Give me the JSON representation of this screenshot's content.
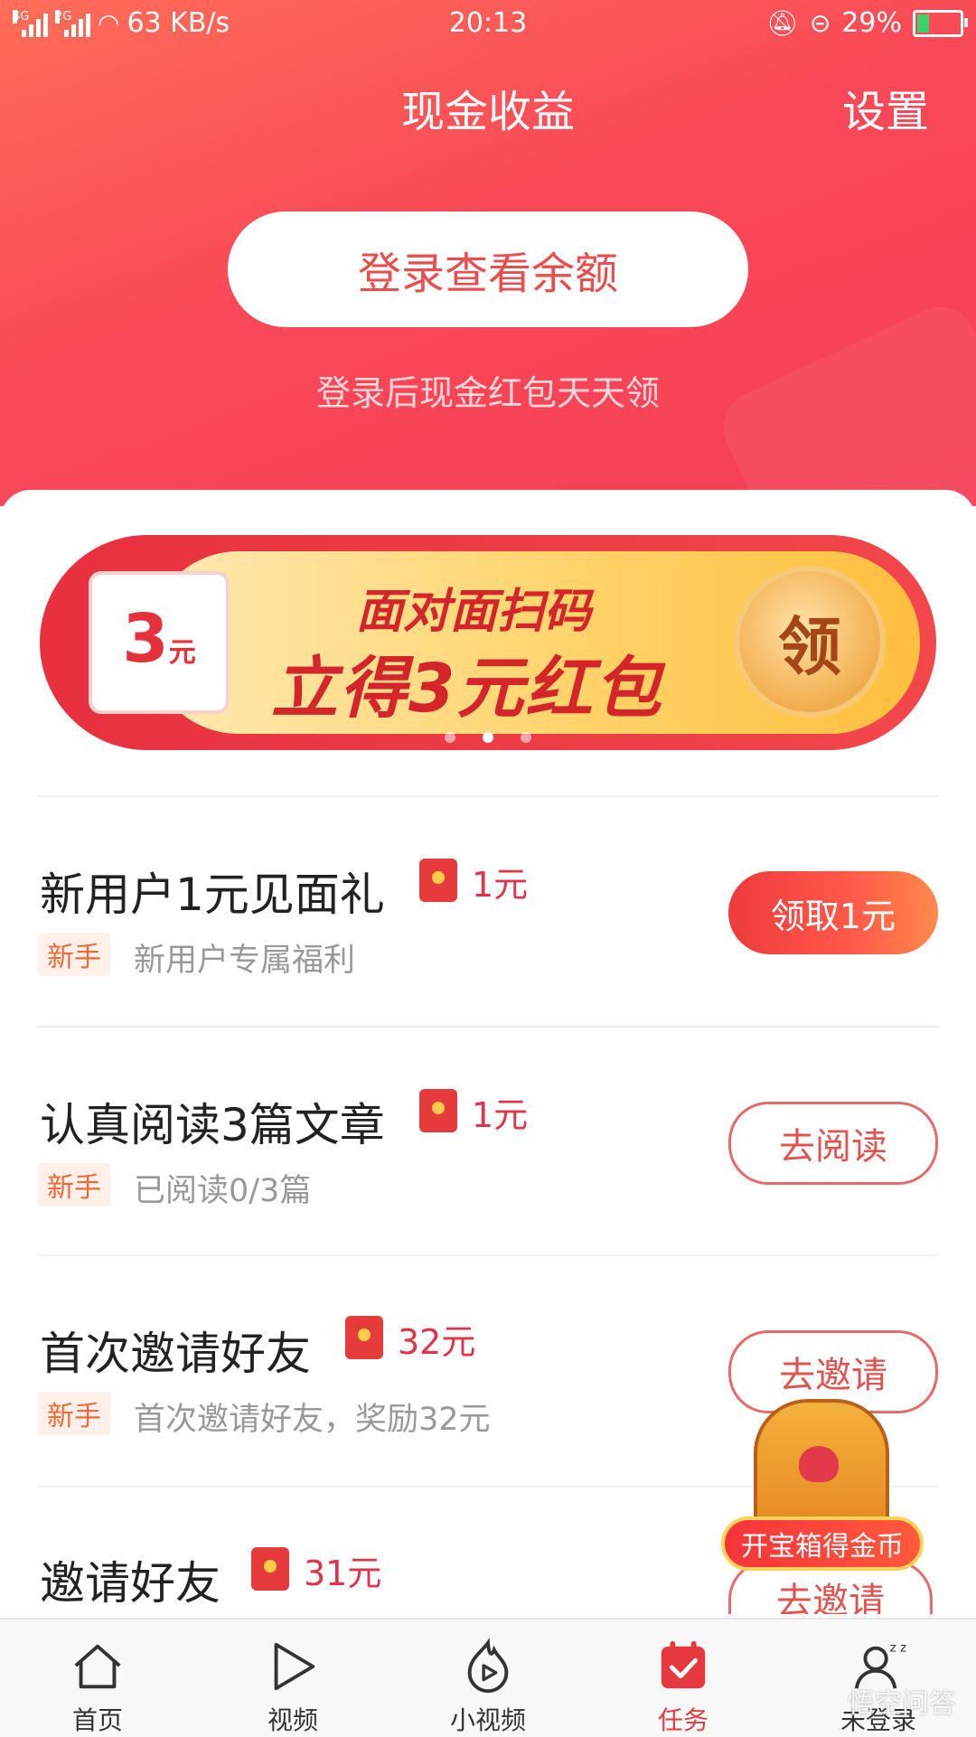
{
  "status_bar": {
    "network_tag_1": "4G",
    "network_tag_2": "2G",
    "speed": "63 KB/s",
    "time": "20:13",
    "battery": "29%"
  },
  "header": {
    "title": "现金收益",
    "settings": "设置",
    "login_button": "登录查看余额",
    "login_hint": "登录后现金红包天天领"
  },
  "banner": {
    "ticket_amount": "3",
    "ticket_unit": "元",
    "line1": "面对面扫码",
    "line2": "立得3元红包",
    "claim": "领",
    "slide_count": 3,
    "active_slide": 2
  },
  "tasks": [
    {
      "title": "新用户1元见面礼",
      "reward": "1元",
      "badge": "新手",
      "subtitle": "新用户专属福利",
      "button": "领取1元"
    },
    {
      "title": "认真阅读3篇文章",
      "reward": "1元",
      "badge": "新手",
      "subtitle": "已阅读0/3篇",
      "button": "去阅读"
    },
    {
      "title": "首次邀请好友",
      "reward": "32元",
      "badge": "新手",
      "subtitle": "首次邀请好友，奖励32元",
      "button": "去邀请"
    },
    {
      "title": "邀请好友",
      "reward": "31元",
      "button": "去邀请"
    }
  ],
  "floating_chest": {
    "label": "开宝箱得金币"
  },
  "tabbar": [
    {
      "label": "首页",
      "icon": "home-icon"
    },
    {
      "label": "视频",
      "icon": "play-icon"
    },
    {
      "label": "小视频",
      "icon": "flame-play-icon"
    },
    {
      "label": "任务",
      "icon": "calendar-check-icon",
      "active": true
    },
    {
      "label": "未登录",
      "icon": "user-sleep-icon"
    }
  ],
  "watermark": "悟空问答",
  "colors": {
    "accent": "#f5455a",
    "button_red": "#ee3b3b",
    "reward_red": "#e0344b",
    "badge_orange": "#ee6a3b"
  }
}
